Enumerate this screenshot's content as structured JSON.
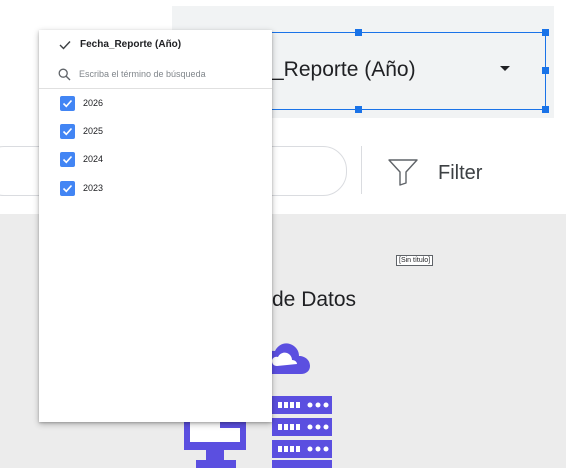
{
  "control": {
    "label": "_Reporte (Año)"
  },
  "filterbar": {
    "filter_label": "Filter"
  },
  "canvas": {
    "untitled_chip": "[Sin título]",
    "heading_fragment": "de Datos"
  },
  "dropdown": {
    "title": "Fecha_Reporte (Año)",
    "search_placeholder": "Escriba el término de búsqueda",
    "items": [
      {
        "label": "2026",
        "checked": true
      },
      {
        "label": "2025",
        "checked": true
      },
      {
        "label": "2024",
        "checked": true
      },
      {
        "label": "2023",
        "checked": true
      }
    ]
  },
  "colors": {
    "accent": "#1a73e8",
    "checkbox": "#4285f4",
    "canvas_bg": "#ececec",
    "illustration_purple": "#5b4fe0"
  }
}
